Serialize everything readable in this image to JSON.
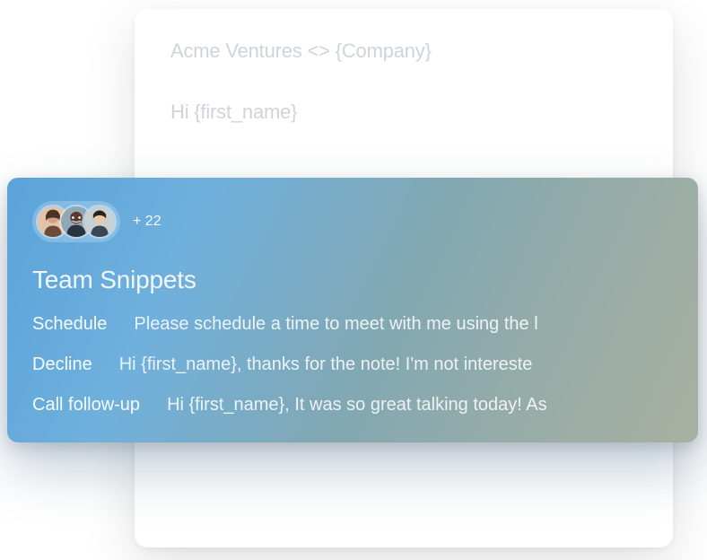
{
  "email": {
    "subject": "Acme Ventures <> {Company}",
    "greeting": "Hi {first_name}"
  },
  "snippets_panel": {
    "more_count": "+ 22",
    "title": "Team Snippets",
    "items": [
      {
        "name": "Schedule",
        "preview": "Please schedule a time to meet with me using the l"
      },
      {
        "name": "Decline",
        "preview": "Hi {first_name}, thanks for the note! I'm not intereste"
      },
      {
        "name": "Call follow-up",
        "preview": "Hi {first_name}, It was so great talking today! As"
      }
    ]
  }
}
